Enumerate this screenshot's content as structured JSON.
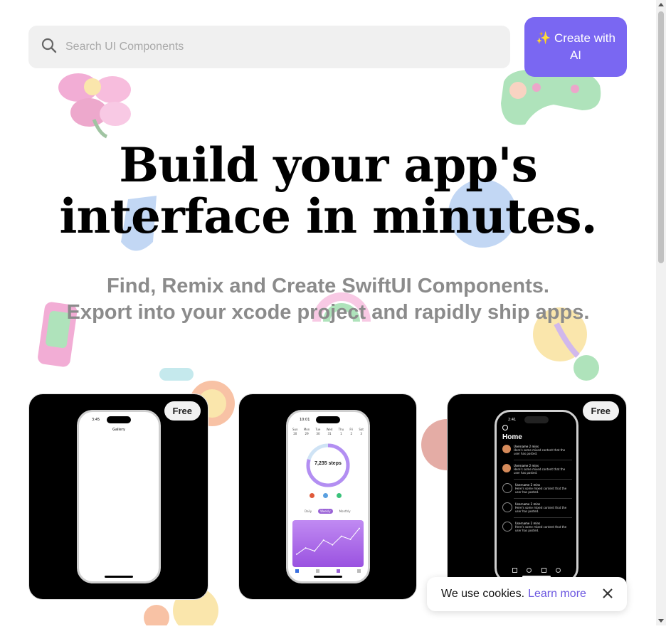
{
  "search": {
    "placeholder": "Search UI Components"
  },
  "header": {
    "create_ai_label": "✨ Create with AI"
  },
  "hero": {
    "title_line1": "Build your app's",
    "title_line2": "interface in minutes.",
    "subtitle_line1": "Find, Remix and Create SwiftUI Components.",
    "subtitle_line2": "Export into your xcode project and rapidly ship apps."
  },
  "cards": [
    {
      "badge": "Free",
      "phone_time": "3:45",
      "screen_title": "Gallery"
    },
    {
      "badge": "",
      "phone_time": "10:01",
      "steps_label": "7,235 steps",
      "week_days": [
        "Sun",
        "Mon",
        "Tue",
        "Wed",
        "Thu",
        "Fri",
        "Sat"
      ],
      "week_dates": [
        "20",
        "29",
        "30",
        "31",
        "1",
        "2",
        "3"
      ],
      "segments": [
        "Daily",
        "Weekly",
        "Monthly"
      ],
      "chart_values": [
        22,
        38,
        30,
        58,
        46,
        68,
        60,
        88
      ]
    },
    {
      "badge": "Free",
      "phone_time": "2:41",
      "screen_title": "Home",
      "post_user": "Username",
      "post_time": "2 mins",
      "post_text": "Here's some mixed content that the user has posted.",
      "posts": 5
    }
  ],
  "cookie": {
    "text": "We use cookies.",
    "link": "Learn more"
  },
  "colors": {
    "accent": "#7a67f2",
    "link": "#6a55e0",
    "ring": "#b38ef2"
  }
}
